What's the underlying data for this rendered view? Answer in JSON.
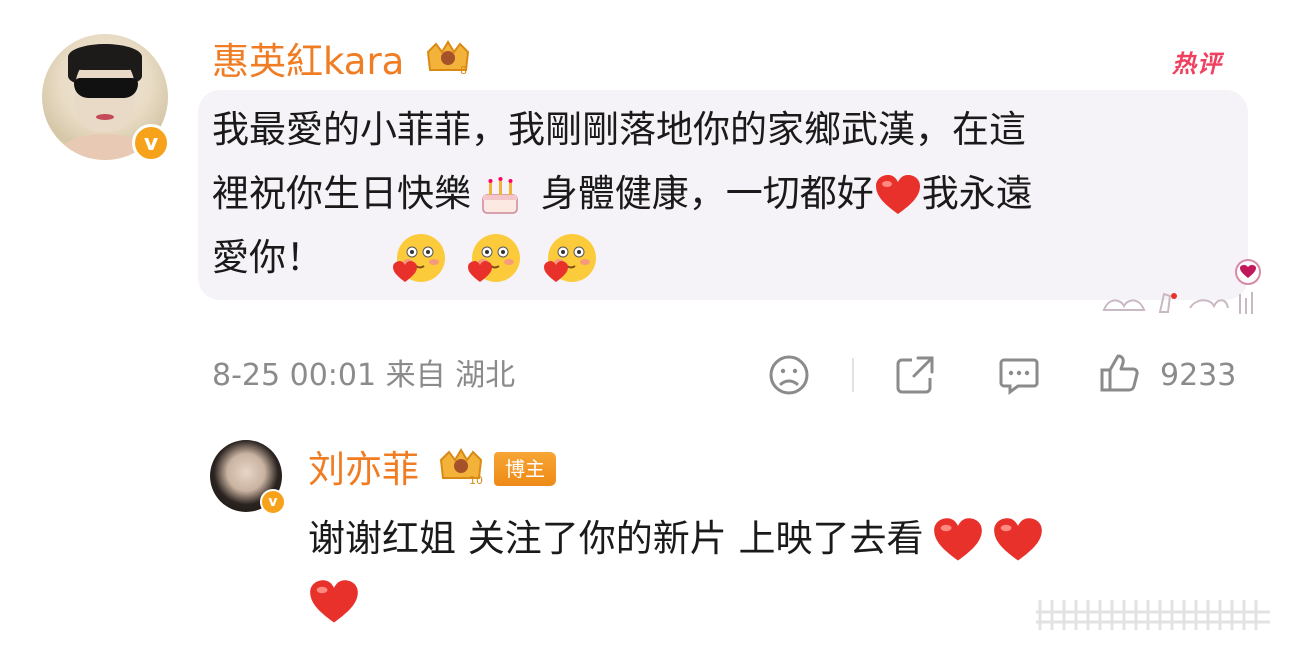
{
  "comment": {
    "username": "惠英紅kara",
    "badge": "热评",
    "text_line1": "我最愛的小菲菲，我剛剛落地你的家鄉武漢，在這",
    "text_line2_a": "裡祝你生日快樂",
    "text_line2_b": " 身體健康，一切都好",
    "text_line2_c": "我永遠",
    "text_line3": "愛你！",
    "timestamp": "8-25 00:01 来自 湖北",
    "likes": "9233"
  },
  "reply": {
    "username": "刘亦菲",
    "role_badge": "博主",
    "text_line1": "谢谢红姐 关注了你的新片 上映了去看"
  },
  "colors": {
    "username": "#f07d24",
    "hot_badge": "#f0405f",
    "verified": "#f7a21b",
    "meta": "#8b8b8b",
    "bubble": "#f6f3f8"
  },
  "icons": [
    "verified-icon",
    "crown-icon",
    "cake-emoji",
    "heart-emoji",
    "blush-face-emoji",
    "sad-face-icon",
    "share-icon",
    "comment-icon",
    "thumbs-up-icon"
  ]
}
